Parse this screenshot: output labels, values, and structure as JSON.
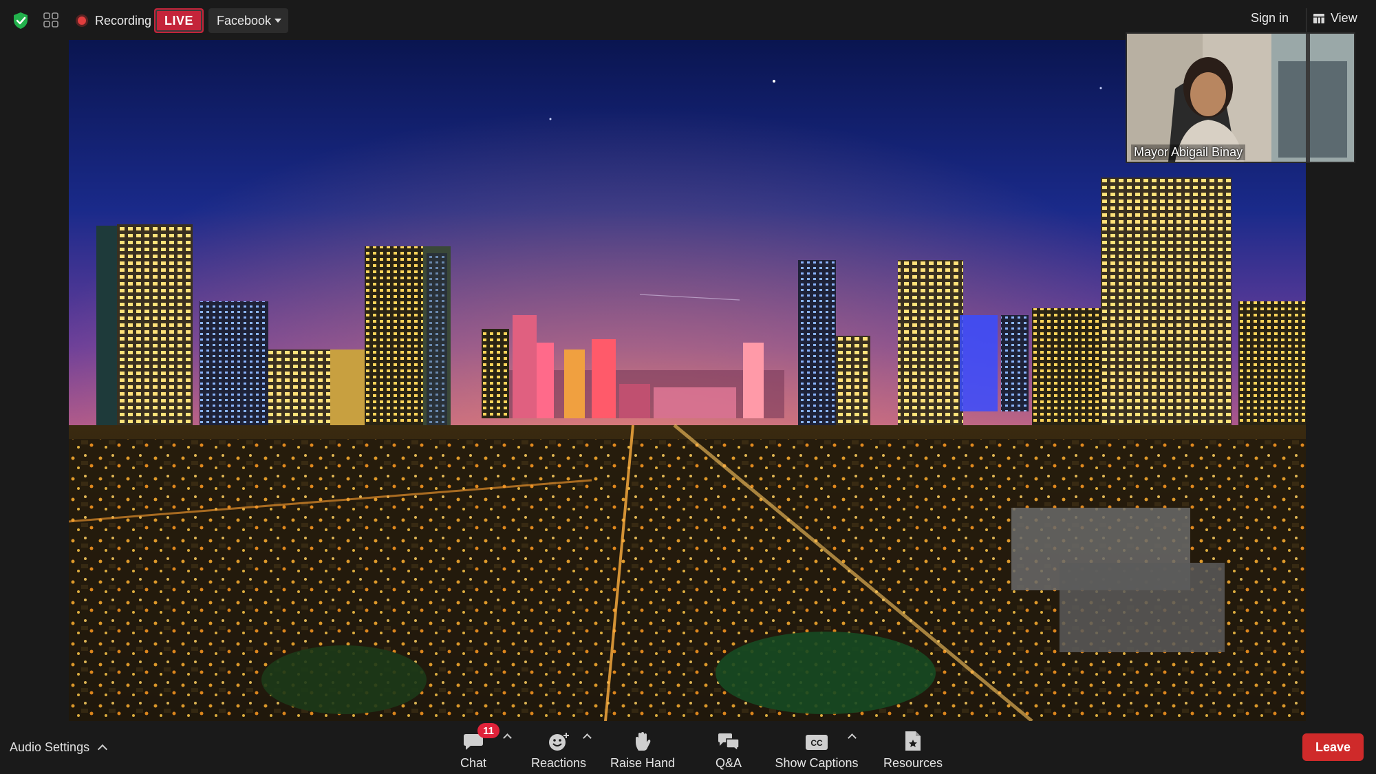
{
  "top_bar": {
    "recording_label": "Recording",
    "live_label": "LIVE",
    "stream_target": "Facebook",
    "sign_in_label": "Sign in",
    "view_label": "View"
  },
  "participant": {
    "name": "Mayor Abigail Binay"
  },
  "toolbar": {
    "audio_settings_label": "Audio Settings",
    "chat_label": "Chat",
    "chat_unread_count": "11",
    "reactions_label": "Reactions",
    "raise_hand_label": "Raise Hand",
    "qa_label": "Q&A",
    "captions_label": "Show Captions",
    "resources_label": "Resources",
    "leave_label": "Leave"
  },
  "colors": {
    "live_red": "#c4243a",
    "leave_red": "#cf2a2a",
    "badge_red": "#e0223a",
    "shield_green": "#22b14c",
    "background": "#1a1a1a"
  }
}
